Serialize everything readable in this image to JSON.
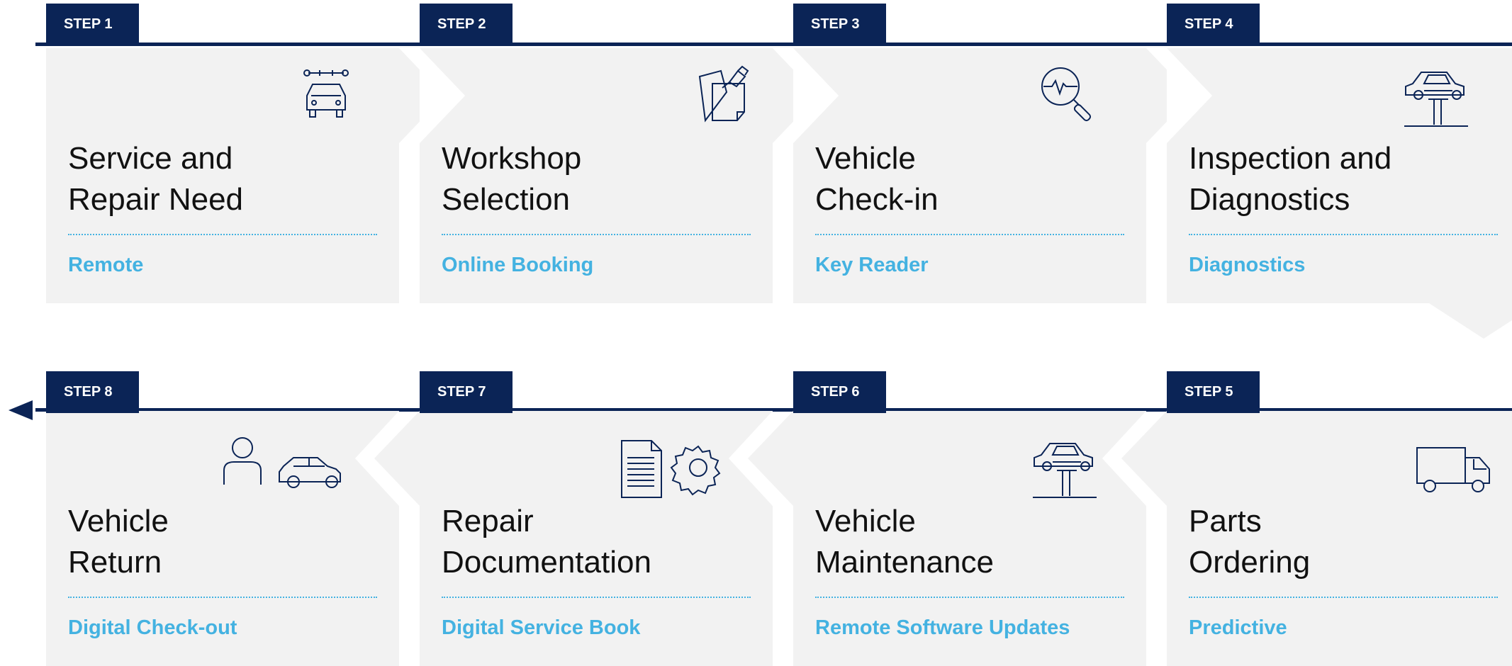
{
  "process": {
    "row1": [
      {
        "step": "STEP 1",
        "title_line1": "Service and",
        "title_line2": "Repair Need",
        "subtitle": "Remote",
        "icon": "car-service-icon"
      },
      {
        "step": "STEP 2",
        "title_line1": "Workshop",
        "title_line2": "Selection",
        "subtitle": "Online Booking",
        "icon": "sticky-notes-pin-icon"
      },
      {
        "step": "STEP 3",
        "title_line1": "Vehicle",
        "title_line2": "Check-in",
        "subtitle": "Key Reader",
        "icon": "diagnostic-magnifier-icon"
      },
      {
        "step": "STEP 4",
        "title_line1": "Inspection and",
        "title_line2": "Diagnostics",
        "subtitle": "Diagnostics",
        "icon": "car-lift-icon"
      }
    ],
    "row2": [
      {
        "step": "STEP 8",
        "title_line1": "Vehicle",
        "title_line2": "Return",
        "subtitle": "Digital Check-out",
        "icon": "person-car-icon"
      },
      {
        "step": "STEP 7",
        "title_line1": "Repair",
        "title_line2": "Documentation",
        "subtitle": "Digital Service Book",
        "icon": "document-gear-icon"
      },
      {
        "step": "STEP 6",
        "title_line1": "Vehicle",
        "title_line2": "Maintenance",
        "subtitle": "Remote Software Updates",
        "icon": "car-lift-icon"
      },
      {
        "step": "STEP 5",
        "title_line1": "Parts",
        "title_line2": "Ordering",
        "subtitle": "Predictive",
        "icon": "delivery-truck-icon"
      }
    ]
  },
  "colors": {
    "navy": "#0b2456",
    "accent": "#44b2e1",
    "card": "#f2f2f2"
  }
}
